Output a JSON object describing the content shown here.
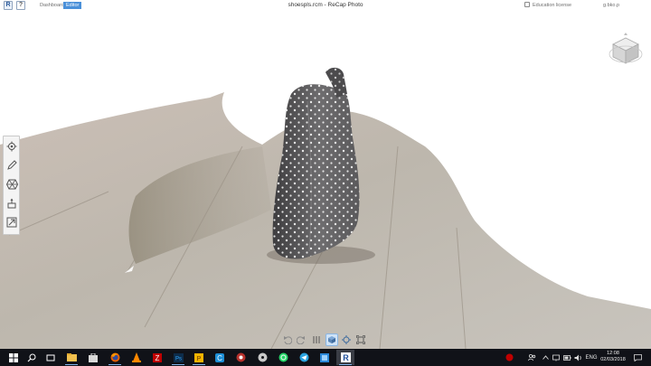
{
  "app": {
    "window_title": "shoespls.rcm - ReCap Photo",
    "logo_letter": "R",
    "help_label": "?",
    "license_label": "Education license",
    "user_label": "g.bko.p"
  },
  "nav": {
    "tabs": [
      {
        "label": "Dashboard",
        "active": false
      },
      {
        "label": "Editor",
        "active": true
      }
    ]
  },
  "colors": {
    "accent": "#4a90d9",
    "taskbar": "#101218",
    "shoe_fabric": "#6b6a6b",
    "dots": "#e6e6e6",
    "floor": "#bdb7ad",
    "floor_dark": "#9a9386"
  },
  "left_tools": [
    {
      "icon": "gear-icon"
    },
    {
      "icon": "pencil-icon"
    },
    {
      "icon": "mesh-icon"
    },
    {
      "icon": "measure-icon"
    },
    {
      "icon": "export-icon"
    }
  ],
  "bottom_toolbar": [
    {
      "icon": "undo-icon"
    },
    {
      "icon": "redo-icon"
    },
    {
      "icon": "slice-icon"
    },
    {
      "icon": "cube-view-icon",
      "active": true
    },
    {
      "icon": "orbit-icon"
    },
    {
      "icon": "fit-view-icon"
    }
  ],
  "taskbar": {
    "apps": [
      "start-icon",
      "search-icon",
      "task-view-icon",
      "file-explorer-icon",
      "store-icon",
      "firefox-icon",
      "vlc-icon",
      "filezilla-icon",
      "photoshop-icon",
      "powerpoint-icon",
      "ccleaner-icon",
      "chrome-icon",
      "dvd-icon",
      "whatsapp-icon",
      "telegram-icon",
      "sticky-notes-icon",
      "recap-icon"
    ],
    "tray": {
      "language": "ENG",
      "time": "12:08",
      "date": "02/03/2018"
    }
  }
}
